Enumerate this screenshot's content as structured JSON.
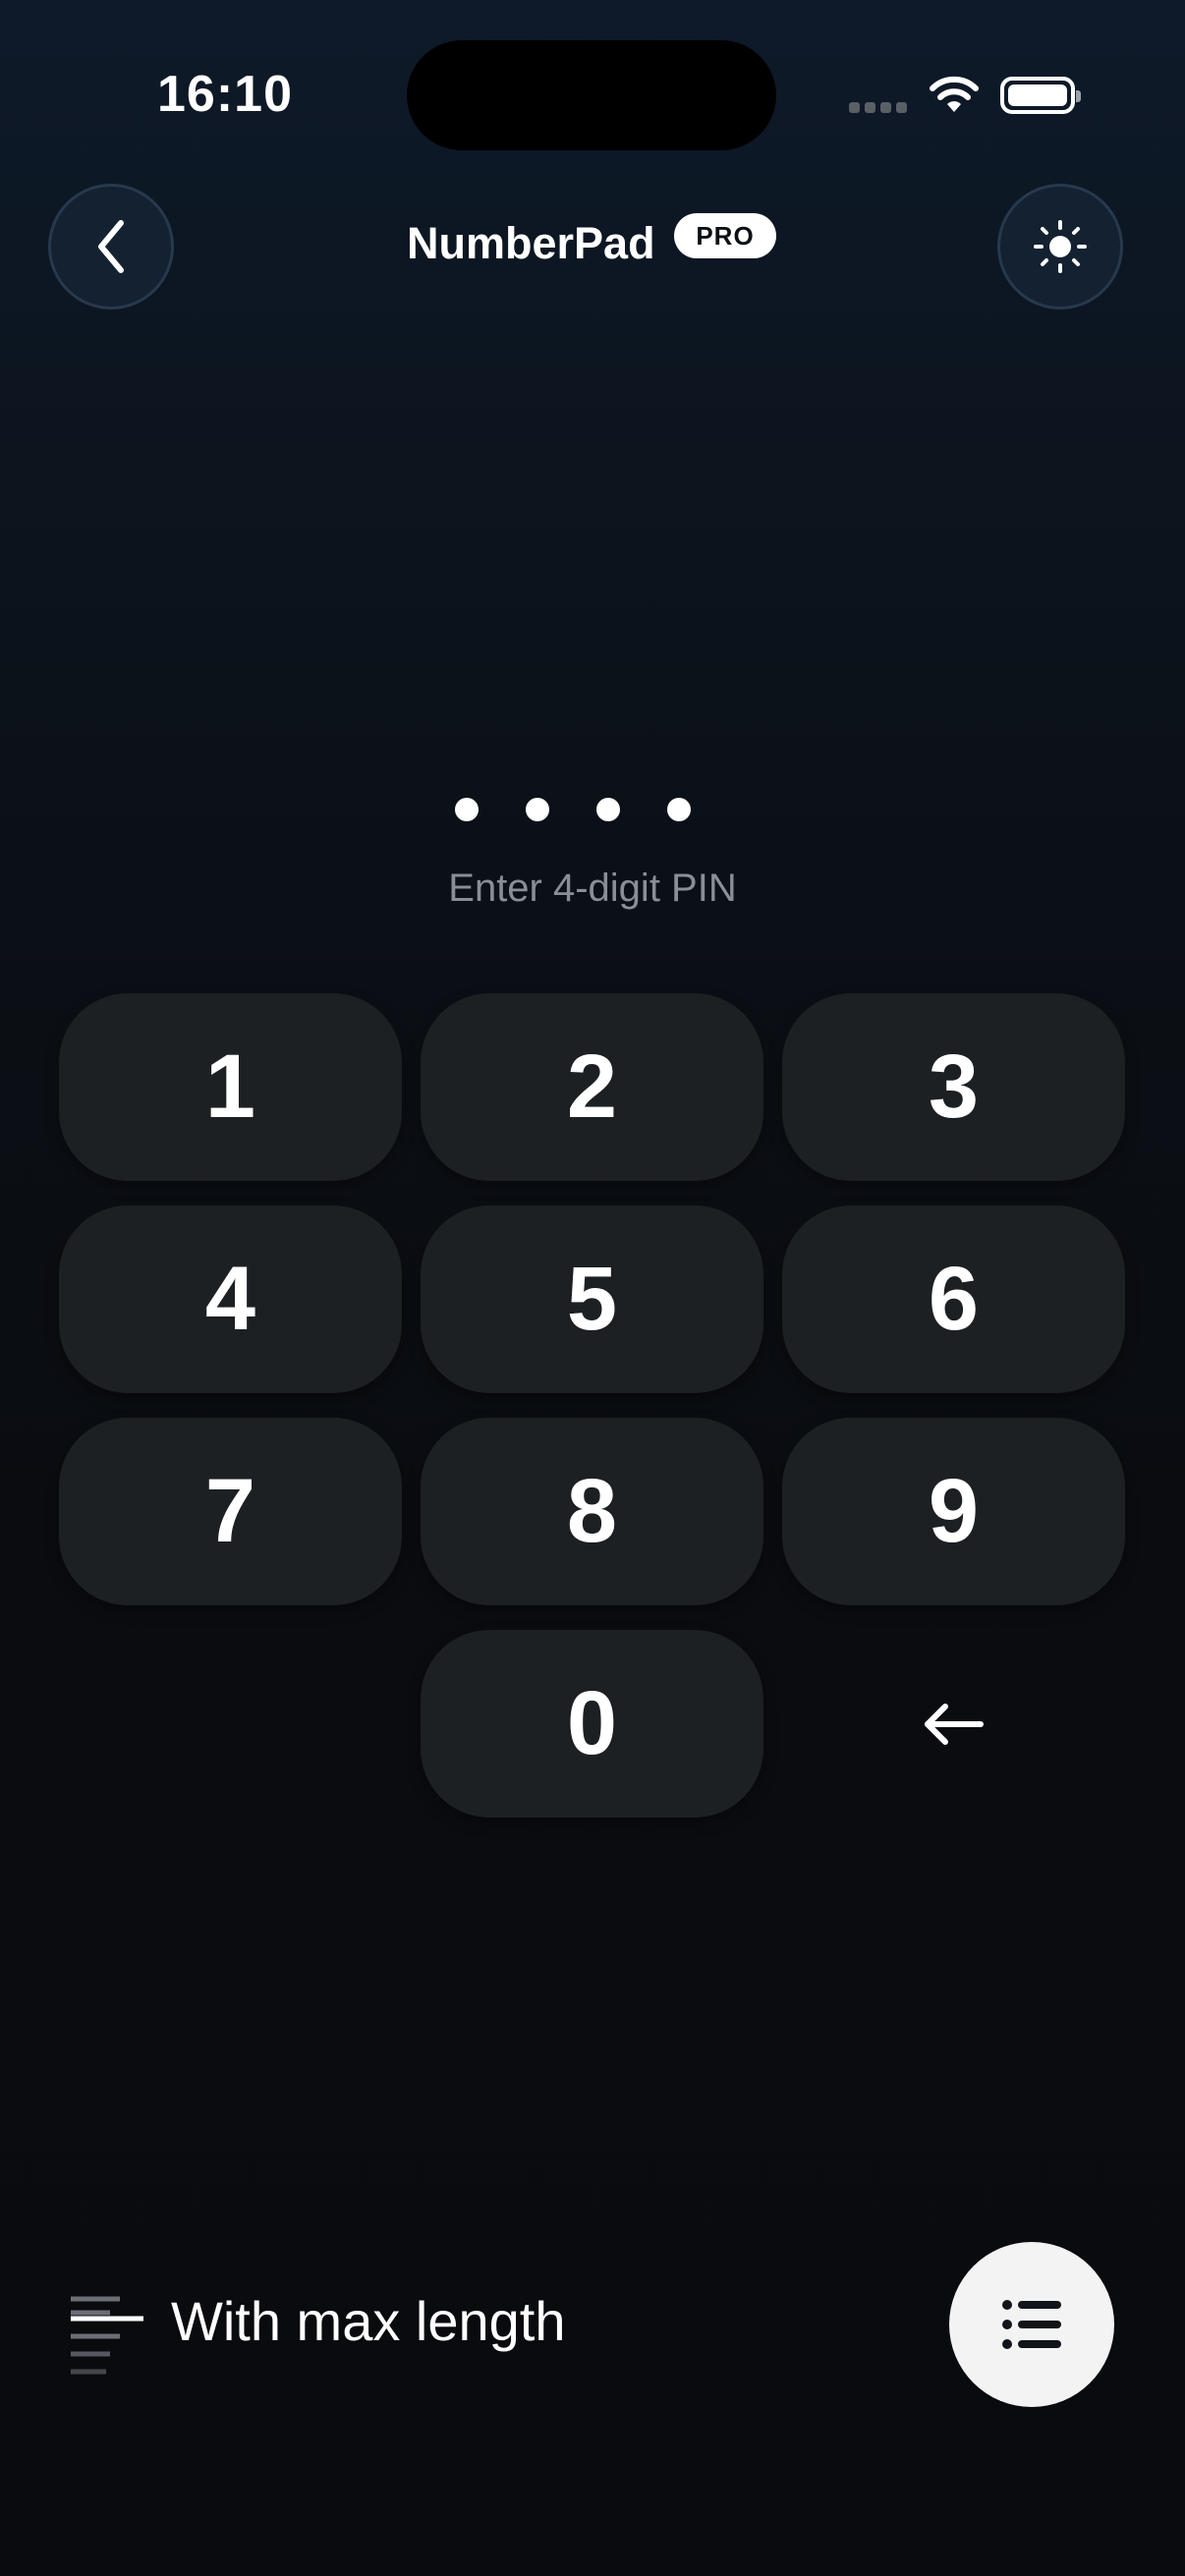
{
  "status_bar": {
    "time": "16:10"
  },
  "header": {
    "title": "NumberPad",
    "badge": "PRO",
    "back_icon": "chevron-left-icon",
    "theme_icon": "sun-icon"
  },
  "pin": {
    "length": 4,
    "hint": "Enter 4-digit PIN"
  },
  "keypad": {
    "keys": [
      "1",
      "2",
      "3",
      "4",
      "5",
      "6",
      "7",
      "8",
      "9",
      "0"
    ],
    "backspace_icon": "arrow-left-icon"
  },
  "footer": {
    "mode_label": "With max length",
    "mode_icon": "text-lines-icon",
    "fab_icon": "list-icon"
  },
  "colors": {
    "background_top": "#0e1a2a",
    "background_bottom": "#0a0b0e",
    "key_fill": "#1c2023",
    "hint_text": "#8a8f96",
    "fab_fill": "#f3f3f3"
  }
}
